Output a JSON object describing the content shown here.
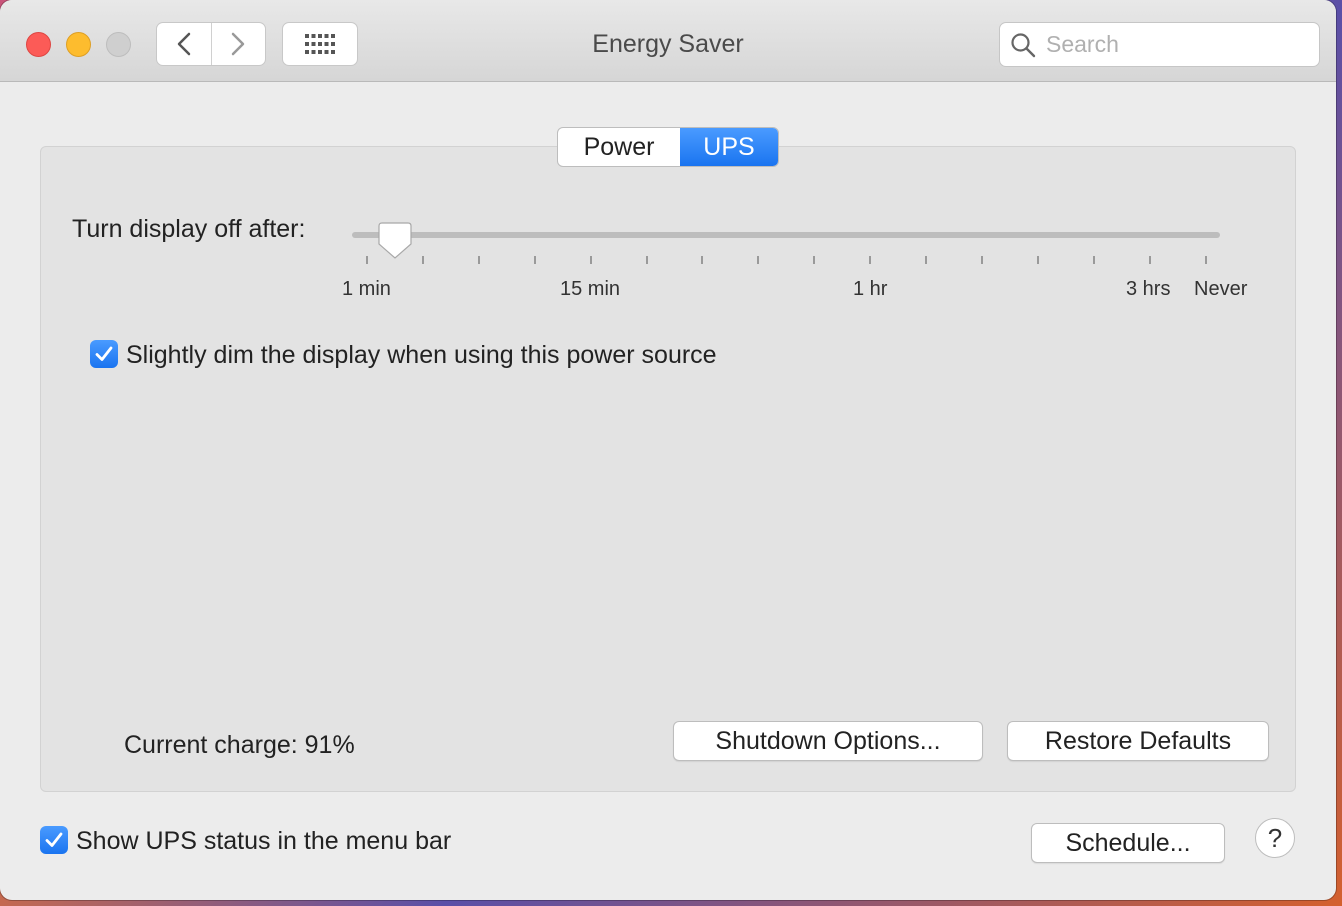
{
  "window": {
    "title": "Energy Saver"
  },
  "toolbar": {
    "back_icon": "chevron-left-icon",
    "forward_icon": "chevron-right-icon",
    "grid_icon": "show-all-grid-icon"
  },
  "search": {
    "placeholder": "Search",
    "icon": "search-icon"
  },
  "tabs": [
    {
      "label": "Power",
      "selected": false
    },
    {
      "label": "UPS",
      "selected": true
    }
  ],
  "display_sleep": {
    "label": "Turn display off after:",
    "value": "1 min",
    "tick_labels": [
      "1 min",
      "15 min",
      "1 hr",
      "3 hrs",
      "Never"
    ]
  },
  "dim_display": {
    "label": "Slightly dim the display when using this power source",
    "checked": true
  },
  "status": {
    "current_charge": "Current charge: 91%"
  },
  "buttons": {
    "shutdown_options": "Shutdown Options...",
    "restore_defaults": "Restore Defaults",
    "schedule": "Schedule...",
    "help": "?"
  },
  "menu_bar_status": {
    "label": "Show UPS status in the menu bar",
    "checked": true
  },
  "colors": {
    "accent": "#1a74f0",
    "close": "#fc5b57",
    "minimize": "#fdbc2e"
  }
}
